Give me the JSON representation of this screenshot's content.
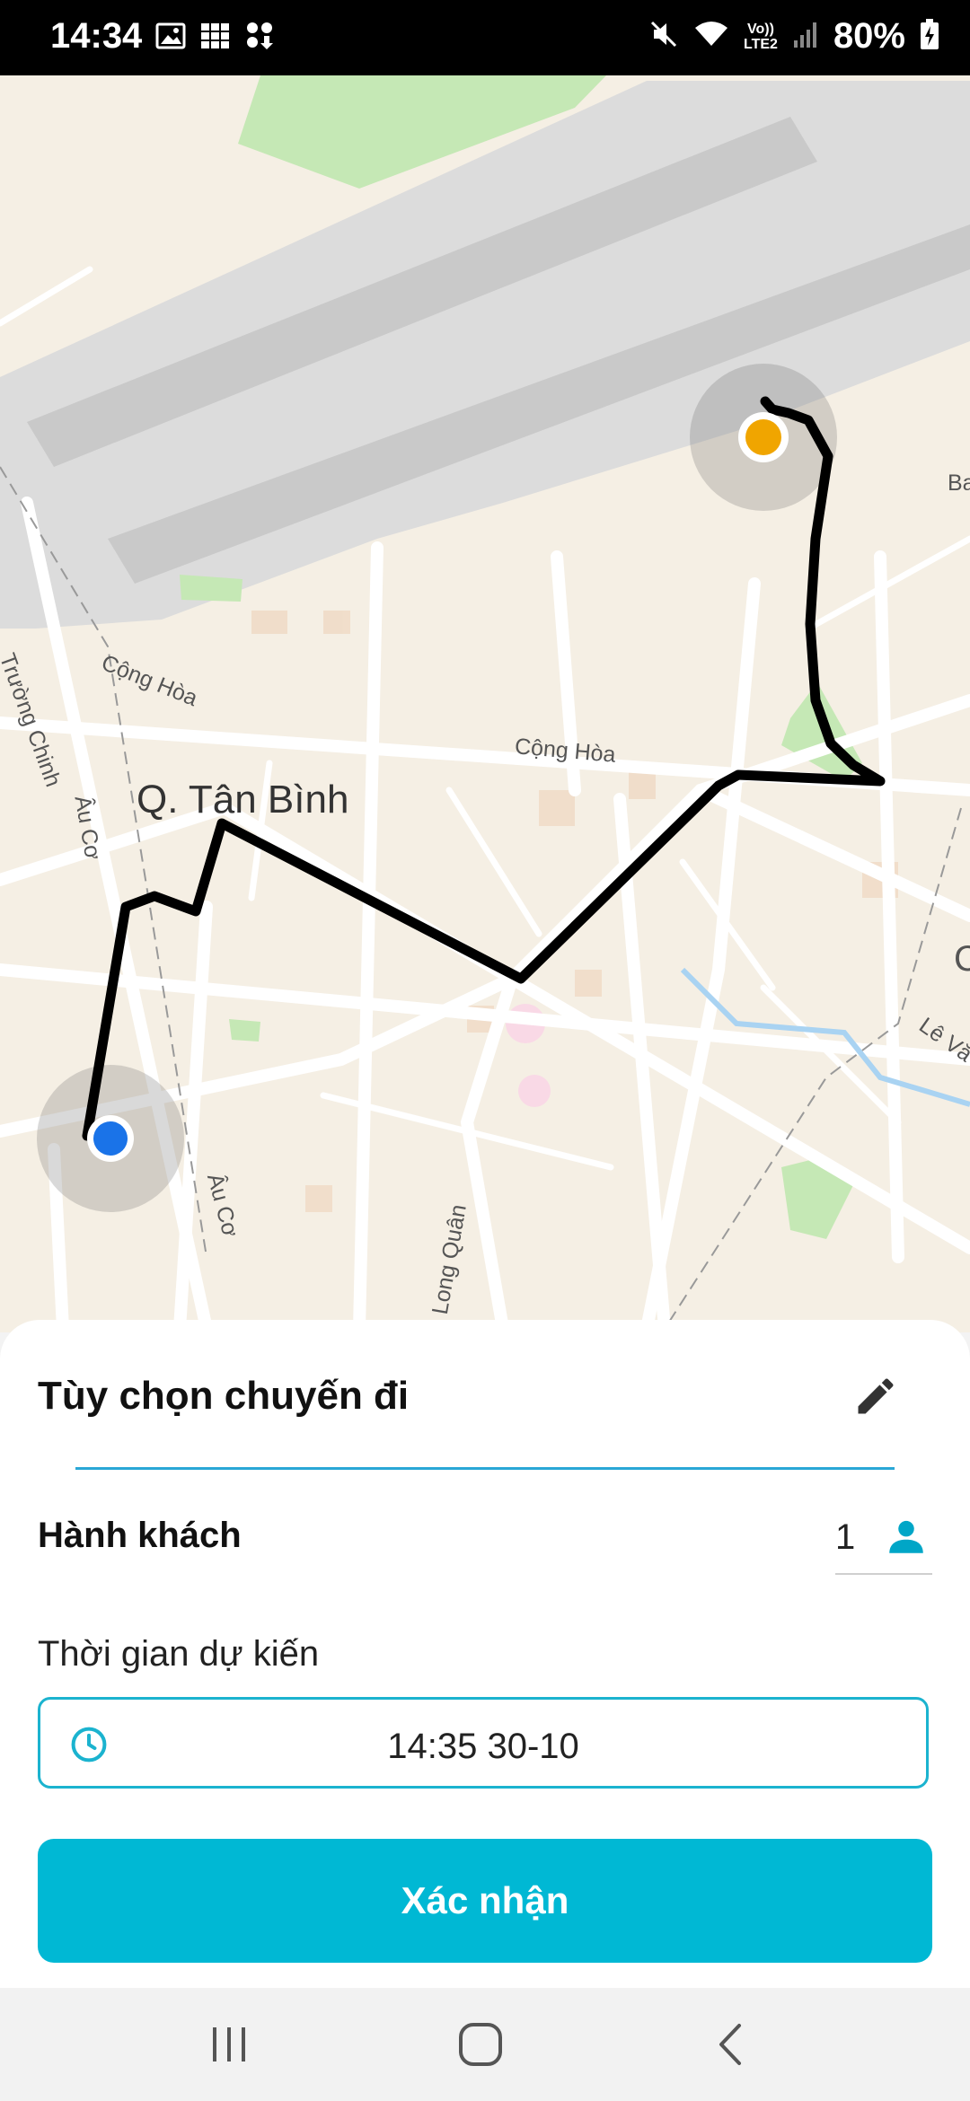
{
  "status_bar": {
    "time": "14:34",
    "battery_percent": "80%",
    "network_label_top": "Vo))",
    "network_label_bottom": "LTE2",
    "left_icons": [
      "image-icon",
      "grid-icon",
      "apps-download-icon"
    ],
    "right_icons": [
      "mute-icon",
      "wifi-icon",
      "signal-icon",
      "battery-charging-icon"
    ]
  },
  "map": {
    "district": "Q. Tân Bình",
    "streets": [
      "Trường Chinh",
      "Cộng Hòa",
      "Cộng Hòa",
      "Âu Cơ",
      "Âu Cơ",
      "ạc Long Quân",
      "Lê Vă",
      "Ba",
      "C"
    ],
    "origin_marker_color": "#1a73e8",
    "destination_marker_color": "#f0a500",
    "route_color": "#000000"
  },
  "sheet": {
    "title": "Tùy chọn chuyến đi",
    "edit_icon": "pencil-icon",
    "passenger_label": "Hành khách",
    "passenger_count": "1",
    "passenger_icon": "person-icon",
    "time_label": "Thời gian dự kiến",
    "time_value": "14:35 30-10",
    "time_icon": "clock-icon",
    "confirm_label": "Xác nhận",
    "accent_color": "#00b8d4"
  },
  "nav_bar": {
    "buttons": [
      "recent-apps-icon",
      "home-icon",
      "back-icon"
    ]
  }
}
